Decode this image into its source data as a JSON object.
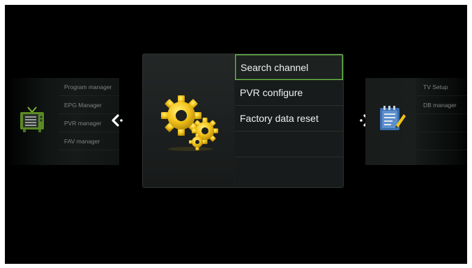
{
  "left_menu": {
    "items": [
      {
        "label": "Program manager"
      },
      {
        "label": "EPG Manager"
      },
      {
        "label": "PVR manager"
      },
      {
        "label": "FAV manager"
      }
    ],
    "icon": "tv-icon"
  },
  "main_menu": {
    "icon": "gears-icon",
    "items": [
      {
        "label": "Search channel",
        "focused": true
      },
      {
        "label": "PVR configure"
      },
      {
        "label": "Factory data reset"
      },
      {
        "label": ""
      },
      {
        "label": ""
      }
    ]
  },
  "right_menu": {
    "items": [
      {
        "label": "TV Setup"
      },
      {
        "label": "DB manager"
      },
      {
        "label": ""
      },
      {
        "label": ""
      }
    ],
    "icon": "notepad-icon"
  },
  "colors": {
    "background": "#000000",
    "focus_border": "#6cc24a",
    "gear": "#f2c21a"
  }
}
